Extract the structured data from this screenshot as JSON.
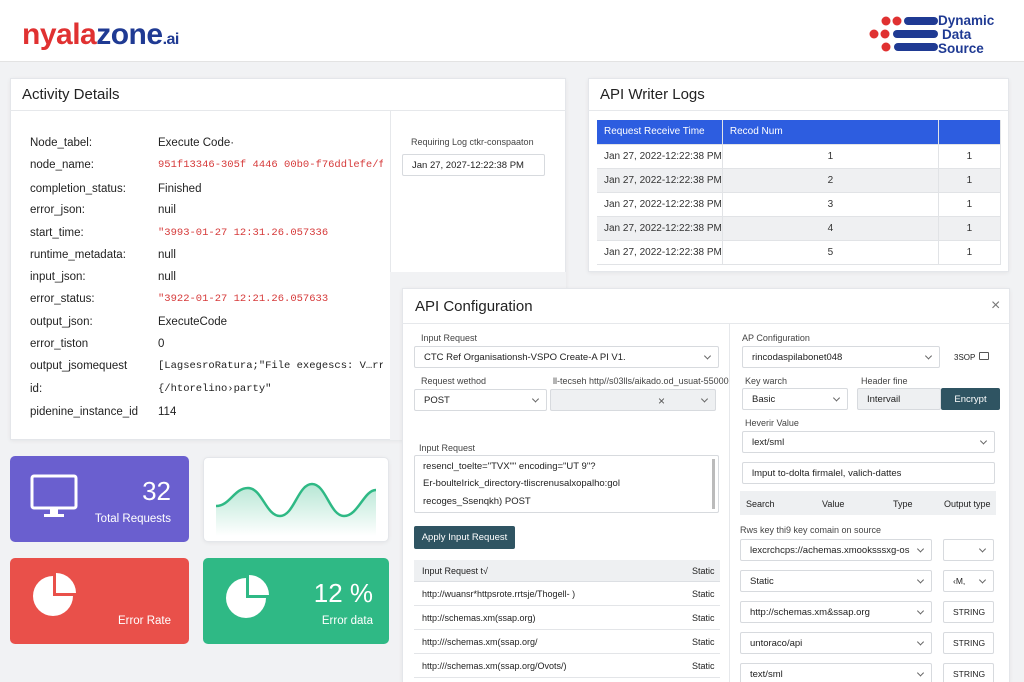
{
  "brand": {
    "logo_part1": "nyala",
    "logo_part2": "zone",
    "logo_suffix": ".ai",
    "dds_line1": "Dynamic",
    "dds_line2": "Data",
    "dds_line3": "Source"
  },
  "activity": {
    "title": "Activity Details",
    "rows": [
      {
        "key": "Node_tabel:",
        "value": "Execute Code·"
      },
      {
        "key": "node_name:",
        "value": "951f13346-305f 4446 00b0-f76ddlefe/f"
      },
      {
        "key": "completion_status:",
        "value": "Finished"
      },
      {
        "key": "error_json:",
        "value": "nuil"
      },
      {
        "key": "start_time:",
        "value": "\"3993-01-27 12:31.26.057336"
      },
      {
        "key": "runtime_metadata:",
        "value": "null"
      },
      {
        "key": "input_json:",
        "value": "null"
      },
      {
        "key": "error_status:",
        "value": "\"3922-01-27 12:21.26.057633"
      },
      {
        "key": "output_json:",
        "value": "ExecuteCode"
      },
      {
        "key": "error_tiston",
        "value": "0"
      },
      {
        "key": "output_jsomequest",
        "value": "[LagsesroRatura;\"File exegescs: V…rriag_vt"
      },
      {
        "key": "id:",
        "value": "{/htorelino›party\""
      },
      {
        "key": "pidenine_instance_id",
        "value": "114"
      }
    ],
    "side_label": "Requiring Log ctkr-conspaaton",
    "side_value": "Jan 27, 2027-12:22:38 PM"
  },
  "logs": {
    "title": "API Writer Logs",
    "headers": [
      "Request Receive Time",
      "Recod Num",
      ""
    ],
    "rows": [
      [
        "Jan 27, 2022-12:22:38 PM",
        "1",
        "1"
      ],
      [
        "Jan 27, 2022-12:22:38 PM",
        "2",
        "1"
      ],
      [
        "Jan 27, 2022-12:22:38 PM",
        "3",
        "1"
      ],
      [
        "Jan 27, 2022-12:22:38 PM",
        "4",
        "1"
      ],
      [
        "Jan 27, 2022-12:22:38 PM",
        "5",
        "1"
      ]
    ]
  },
  "stats": {
    "total_value": "32",
    "total_label": "Total Requests",
    "error_rate_label": "Error Rate",
    "error_data_value": "12 %",
    "error_data_label": "Error data"
  },
  "config": {
    "title": "API Configuration",
    "close": "×",
    "input_request_label": "Input Request",
    "input_request_value": "CTC  Ref Organisationsh-VSPO Create-A PI V1.",
    "method_label": "Request wethod",
    "method_value": "POST",
    "url_label": "ll-tecseh http//s03lls/aikado.od_usuat-55000",
    "clear": "×",
    "body_label": "Input Request",
    "body_lines": [
      "resencl_toelte=\"TVX\"\" encoding=\"UT 9\"?",
      "Er-boulteIrick_directory-tliscrenusalxopalho:gol",
      "recoges_Ssenqkh) POST"
    ],
    "apply_label": "Apply Input Request",
    "tbl_header": "Input Request t√",
    "tbl_header2": "Static",
    "tbl_rows": [
      [
        "http://wuansr*httpsrote.rrtsje/Thogell- )",
        "Static"
      ],
      [
        "http://schemas.xm(ssap.org)",
        "Static"
      ],
      [
        "http:///schemas.xm(ssap.org/",
        "Static"
      ],
      [
        "http:///schemas.xm(ssap.org/Ovots/)",
        "Static"
      ]
    ],
    "right_label": "AP Configuration",
    "right_select": "rincodaspilabonet048",
    "right_badge": "3SOP",
    "key_label": "Key warch",
    "key_value": "Basic",
    "header_label": "Header fine",
    "header_value": "Intervail",
    "encrypt_label": "Encrypt",
    "heverir_label": "Heverir Value",
    "heverir_value": "lext/sml",
    "import_value": "lmput to-dolta firmalel, valich-dattes",
    "map_headers": [
      "Search",
      "Value",
      "Type",
      "Output type"
    ],
    "rws_label": "Rws key thi9 key comain on source",
    "map_rows": [
      {
        "left": "lexcrchcps://achemas.xmooksssxg-os",
        "right": ""
      },
      {
        "left": "Static",
        "right": "‹M,"
      },
      {
        "left": "http://schemas.xm&ssap.org",
        "right": "STRING"
      },
      {
        "left": "untoraco/api",
        "right": "STRING"
      },
      {
        "left": "text/sml",
        "right": "STRING"
      }
    ]
  },
  "colors": {
    "accent": "#2d5de0",
    "purple": "#6a5fcf",
    "red": "#e9504a",
    "green": "#2fb985",
    "dark": "#2f5462"
  }
}
